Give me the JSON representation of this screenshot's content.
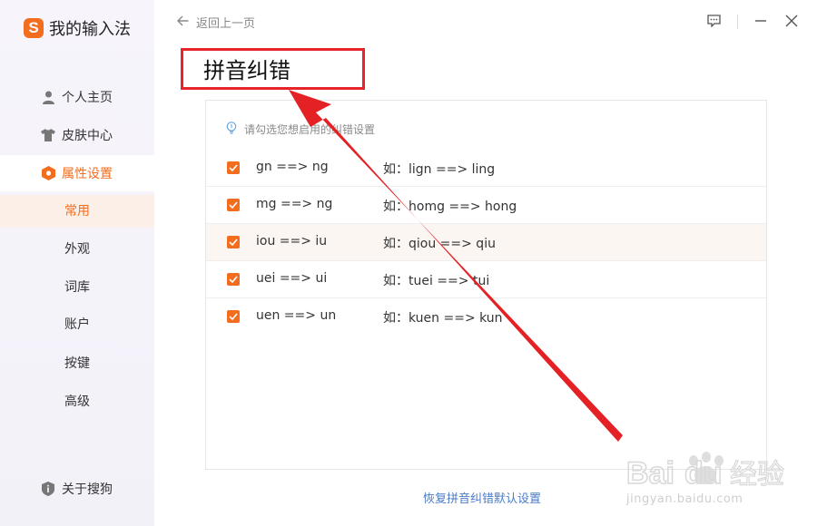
{
  "app": {
    "brand_logo": "S",
    "brand_name": "我的输入法"
  },
  "sidebar": {
    "items": [
      {
        "label": "个人主页",
        "icon": "person-icon"
      },
      {
        "label": "皮肤中心",
        "icon": "shirt-icon"
      },
      {
        "label": "属性设置",
        "icon": "settings-hex-icon",
        "active": true
      }
    ],
    "sub_items": [
      {
        "label": "常用",
        "active": true
      },
      {
        "label": "外观"
      },
      {
        "label": "词库"
      },
      {
        "label": "账户"
      },
      {
        "label": "按键"
      },
      {
        "label": "高级"
      }
    ],
    "about": {
      "label": "关于搜狗",
      "icon": "info-shield-icon"
    }
  },
  "header": {
    "back_label": "返回上一页",
    "icons": [
      "feedback-icon",
      "minimize-icon",
      "close-icon"
    ]
  },
  "main": {
    "title": "拼音纠错",
    "hint": "请勾选您想启用的纠错设置",
    "rules": [
      {
        "rule": "gn ==> ng",
        "example": "如：lign ==> ling",
        "checked": true
      },
      {
        "rule": "mg ==> ng",
        "example": "如：homg ==> hong",
        "checked": true
      },
      {
        "rule": "iou ==> iu",
        "example": "如：qiou ==> qiu",
        "checked": true
      },
      {
        "rule": "uei ==> ui",
        "example": "如：tuei ==> tui",
        "checked": true
      },
      {
        "rule": "uen ==> un",
        "example": "如：kuen ==> kun",
        "checked": true
      }
    ],
    "restore_label": "恢复拼音纠错默认设置"
  },
  "watermark": {
    "main": "Bai du 经验",
    "sub": "jingyan.baidu.com"
  },
  "colors": {
    "accent": "#f36d1f",
    "annotation": "#e8242b",
    "link": "#4a7bc8"
  }
}
